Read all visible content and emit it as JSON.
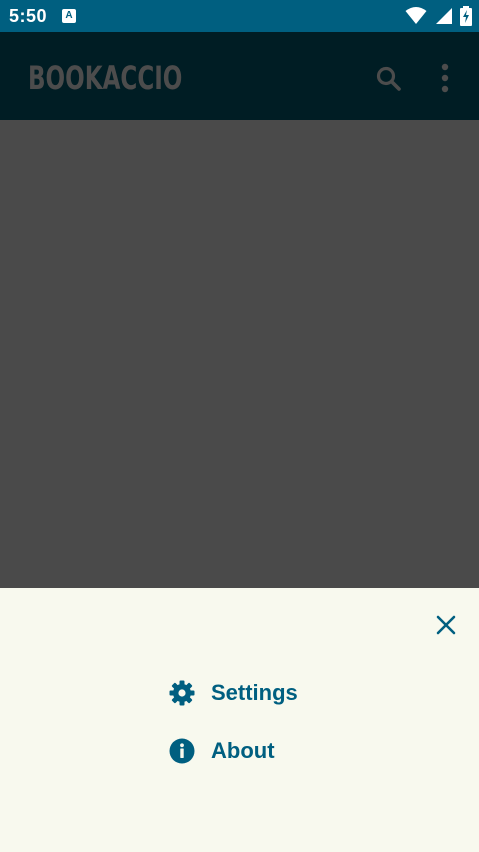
{
  "status_bar": {
    "time": "5:50",
    "notification_glyph": "A",
    "icons": [
      "wifi-icon",
      "cellular-icon",
      "battery-charging-icon"
    ]
  },
  "app_bar": {
    "title": "BOOKACCIO",
    "actions": [
      "search-icon",
      "more-vert-icon"
    ]
  },
  "bottom_sheet": {
    "close_icon": "close-icon",
    "items": [
      {
        "label": "Settings",
        "icon": "gear-icon"
      },
      {
        "label": "About",
        "icon": "info-icon"
      }
    ]
  },
  "colors": {
    "status_bar": "#005f80",
    "app_bar": "#001d24",
    "scrim": "#4a4a4a",
    "sheet": "#f8f9ee",
    "accent": "#005f80"
  }
}
